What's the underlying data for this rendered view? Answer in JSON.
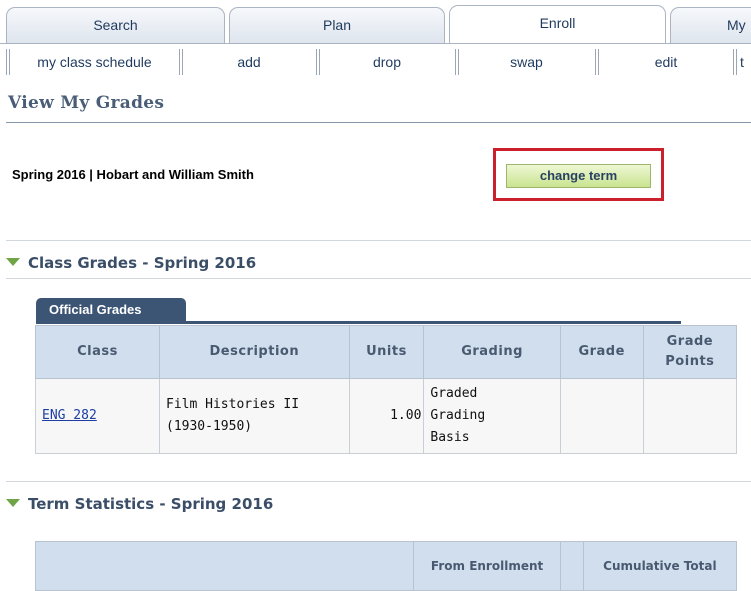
{
  "tabs": [
    {
      "label": "Search"
    },
    {
      "label": "Plan"
    },
    {
      "label": "Enroll"
    },
    {
      "label": "My"
    }
  ],
  "subnav": [
    {
      "label": "my class schedule"
    },
    {
      "label": "add"
    },
    {
      "label": "drop"
    },
    {
      "label": "swap"
    },
    {
      "label": "edit"
    },
    {
      "label": "t"
    }
  ],
  "page": {
    "title": "View My Grades"
  },
  "term": {
    "label": "Spring 2016 | Hobart and William Smith",
    "change_button": "change term"
  },
  "class_grades": {
    "header": "Class Grades - Spring 2016",
    "tab": "Official Grades",
    "columns": [
      "Class",
      "Description",
      "Units",
      "Grading",
      "Grade",
      "Grade Points"
    ],
    "rows": [
      {
        "class": "ENG 282",
        "description": "Film Histories II (1930-1950)",
        "units": "1.00",
        "grading": "Graded Grading Basis",
        "grade": "",
        "grade_points": ""
      }
    ]
  },
  "term_statistics": {
    "header": "Term Statistics - Spring 2016",
    "columns": [
      "",
      "From Enrollment",
      "",
      "Cumulative Total"
    ]
  },
  "colors": {
    "highlight": "#cc1f2c",
    "button": "#c9e48f",
    "grid_header": "#d1deee",
    "grid_tab": "#3c5575"
  }
}
